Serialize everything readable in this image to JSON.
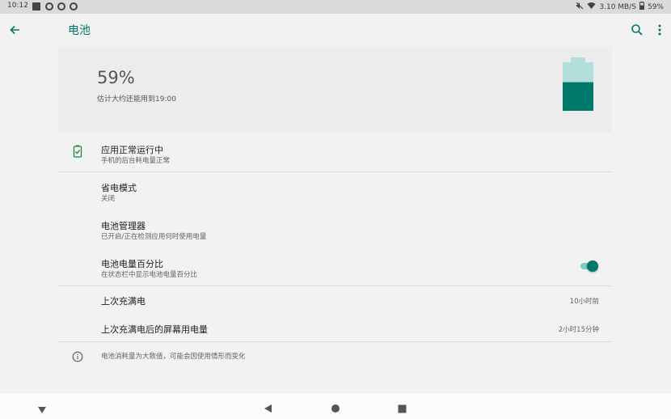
{
  "status_bar": {
    "time": "10:12",
    "network_speed": "3.10 MB/S",
    "battery": "59%"
  },
  "app_bar": {
    "title": "电池"
  },
  "hero": {
    "percent": "59%",
    "estimate": "估计大约还能用到19:00",
    "level": 0.59
  },
  "items": {
    "app_status": {
      "title": "应用正常运行中",
      "subtitle": "手机的后台耗电量正常"
    },
    "battery_saver": {
      "title": "省电模式",
      "subtitle": "关闭"
    },
    "battery_manager": {
      "title": "电池管理器",
      "subtitle": "已开启/正在检测应用何时使用电量"
    },
    "battery_percentage": {
      "title": "电池电量百分比",
      "subtitle": "在状态栏中显示电池电量百分比",
      "enabled": true
    },
    "last_full_charge": {
      "title": "上次充满电",
      "value": "10小时前"
    },
    "screen_usage": {
      "title": "上次充满电后的屏幕用电量",
      "value": "2小时15分钟"
    }
  },
  "footer": {
    "info": "电池消耗量为大致值，可能会因使用情形而变化"
  },
  "colors": {
    "accent": "#00796b",
    "accent_light": "#b2dfdb"
  }
}
